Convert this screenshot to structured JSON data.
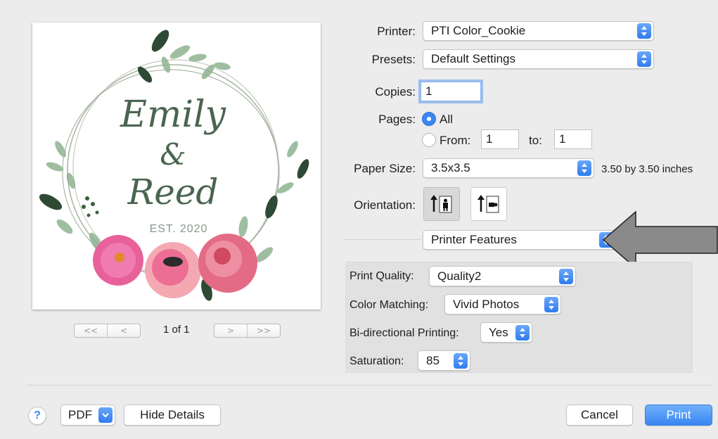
{
  "preview": {
    "name_1": "Emily",
    "ampersand": "&",
    "name_2": "Reed",
    "est": "EST. 2020",
    "page_indicator": "1 of 1",
    "first_label": "<<",
    "prev_label": "<",
    "next_label": ">",
    "last_label": ">>"
  },
  "form": {
    "printer_label": "Printer:",
    "printer_value": "PTI Color_Cookie",
    "presets_label": "Presets:",
    "presets_value": "Default Settings",
    "copies_label": "Copies:",
    "copies_value": "1",
    "pages_label": "Pages:",
    "pages_all_label": "All",
    "pages_from_label": "From:",
    "pages_from_value": "1",
    "pages_to_label": "to:",
    "pages_to_value": "1",
    "paper_size_label": "Paper Size:",
    "paper_size_value": "3.5x3.5",
    "paper_size_desc": "3.50 by 3.50 inches",
    "orientation_label": "Orientation:",
    "section_value": "Printer Features"
  },
  "features": {
    "print_quality_label": "Print Quality:",
    "print_quality_value": "Quality2",
    "color_matching_label": "Color Matching:",
    "color_matching_value": "Vivid Photos",
    "bidirectional_label": "Bi-directional Printing:",
    "bidirectional_value": "Yes",
    "saturation_label": "Saturation:",
    "saturation_value": "85"
  },
  "footer": {
    "help_label": "?",
    "pdf_label": "PDF",
    "hide_details_label": "Hide Details",
    "cancel_label": "Cancel",
    "print_label": "Print"
  },
  "colors": {
    "accent": "#3b86f3",
    "arrow_fill": "#8a8a8a"
  }
}
